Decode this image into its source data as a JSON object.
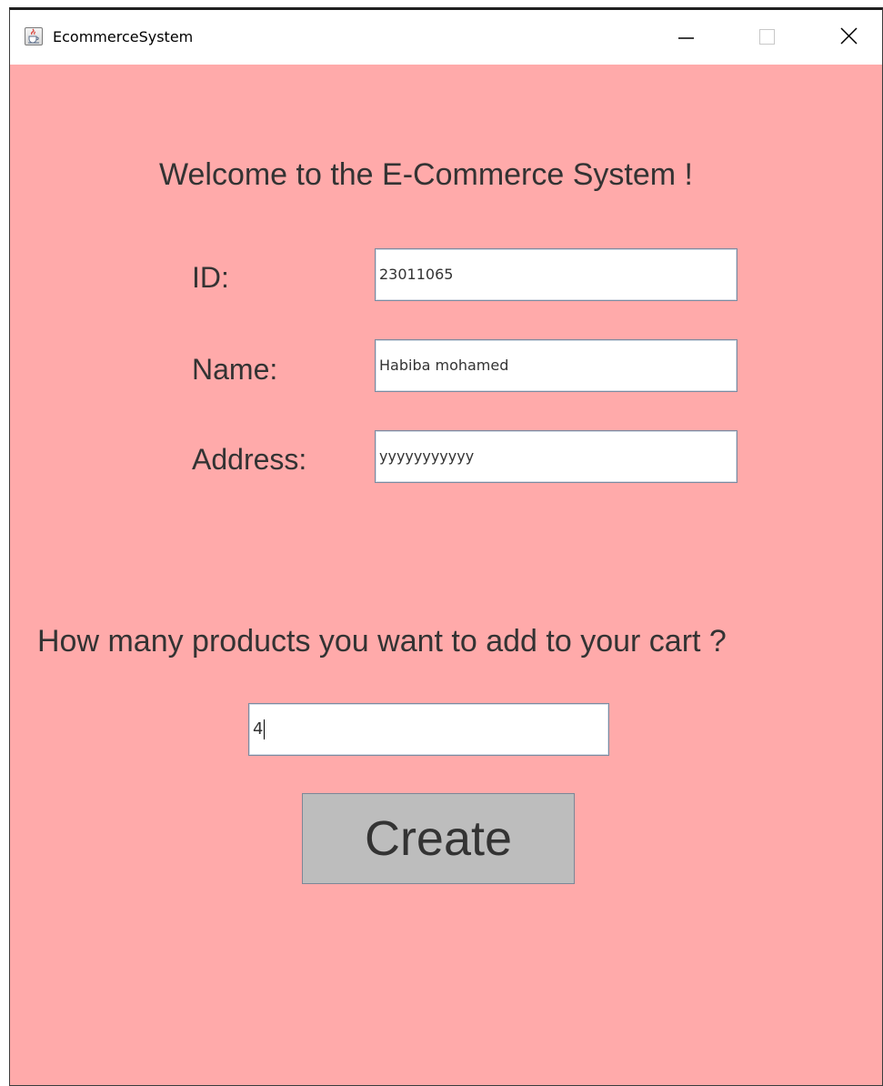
{
  "window": {
    "title": "EcommerceSystem",
    "icon": "java-cup-icon",
    "controls": {
      "minimize": "minimize-icon",
      "maximize": "maximize-icon",
      "close": "close-icon"
    }
  },
  "form": {
    "welcome_text": "Welcome to the E-Commerce System !",
    "fields": {
      "id": {
        "label": "ID:",
        "value": "23011065"
      },
      "name": {
        "label": "Name:",
        "value": "Habiba mohamed"
      },
      "address": {
        "label": "Address:",
        "value": "yyyyyyyyyyy"
      }
    },
    "quantity": {
      "question": "How many products you want to add to your cart ?",
      "value": "4"
    },
    "create_label": "Create"
  },
  "colors": {
    "background": "#ffaaaa",
    "button": "#bdbdbd",
    "text": "#333333"
  }
}
